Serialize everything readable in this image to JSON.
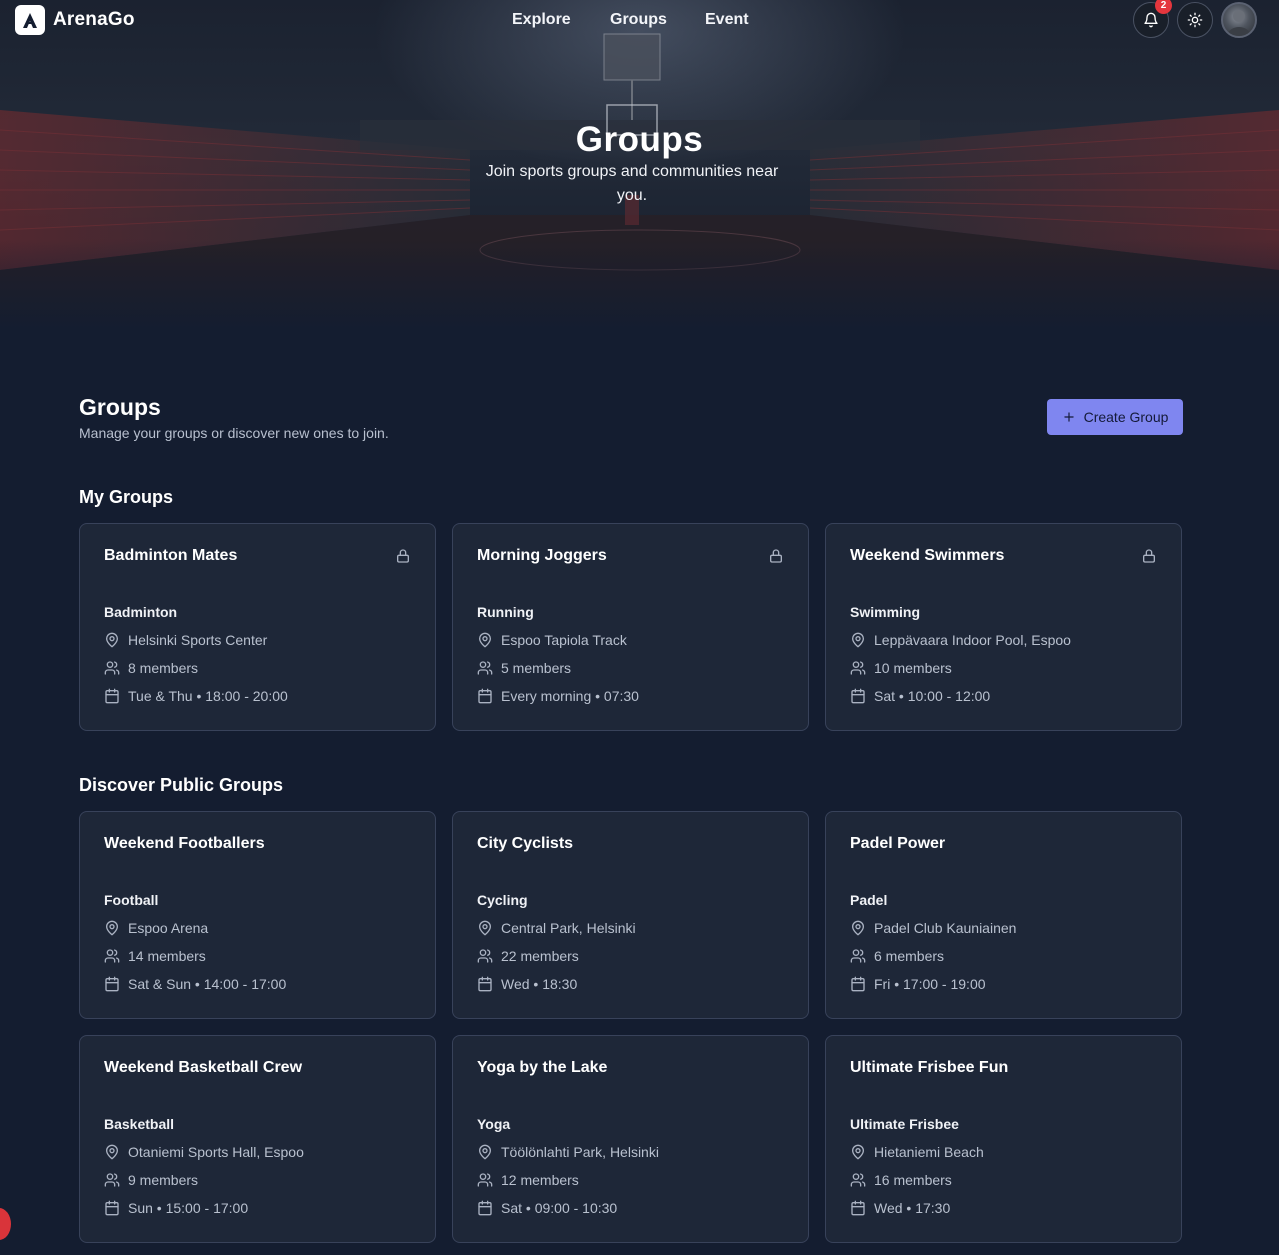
{
  "brand": {
    "name": "ArenaGo"
  },
  "nav": {
    "links": [
      "Explore",
      "Groups",
      "Event"
    ],
    "notifications_count": "2"
  },
  "hero": {
    "title": "Groups",
    "subtitle": "Join sports groups and communities near you."
  },
  "header": {
    "title": "Groups",
    "subtitle": "Manage your groups or discover new ones to join.",
    "create_button": "Create Group"
  },
  "my_groups": {
    "title": "My Groups",
    "cards": [
      {
        "name": "Badminton Mates",
        "sport": "Badminton",
        "location": "Helsinki Sports Center",
        "members": "8 members",
        "schedule": "Tue & Thu • 18:00 - 20:00",
        "private": true
      },
      {
        "name": "Morning Joggers",
        "sport": "Running",
        "location": "Espoo Tapiola Track",
        "members": "5 members",
        "schedule": "Every morning • 07:30",
        "private": true
      },
      {
        "name": "Weekend Swimmers",
        "sport": "Swimming",
        "location": "Leppävaara Indoor Pool, Espoo",
        "members": "10 members",
        "schedule": "Sat • 10:00 - 12:00",
        "private": true
      }
    ]
  },
  "public_groups": {
    "title": "Discover Public Groups",
    "cards": [
      {
        "name": "Weekend Footballers",
        "sport": "Football",
        "location": "Espoo Arena",
        "members": "14 members",
        "schedule": "Sat & Sun • 14:00 - 17:00"
      },
      {
        "name": "City Cyclists",
        "sport": "Cycling",
        "location": "Central Park, Helsinki",
        "members": "22 members",
        "schedule": "Wed • 18:30"
      },
      {
        "name": "Padel Power",
        "sport": "Padel",
        "location": "Padel Club Kauniainen",
        "members": "6 members",
        "schedule": "Fri • 17:00 - 19:00"
      },
      {
        "name": "Weekend Basketball Crew",
        "sport": "Basketball",
        "location": "Otaniemi Sports Hall, Espoo",
        "members": "9 members",
        "schedule": "Sun • 15:00 - 17:00"
      },
      {
        "name": "Yoga by the Lake",
        "sport": "Yoga",
        "location": "Töölönlahti Park, Helsinki",
        "members": "12 members",
        "schedule": "Sat • 09:00 - 10:30"
      },
      {
        "name": "Ultimate Frisbee Fun",
        "sport": "Ultimate Frisbee",
        "location": "Hietaniemi Beach",
        "members": "16 members",
        "schedule": "Wed • 17:30"
      }
    ]
  },
  "colors": {
    "background": "#141d30",
    "card": "#1e2738",
    "accent": "#7f86f0",
    "badge": "#e5363d"
  },
  "icons": [
    "bell-icon",
    "sun-icon",
    "lock-icon",
    "map-pin-icon",
    "users-icon",
    "calendar-icon",
    "plus-icon"
  ]
}
